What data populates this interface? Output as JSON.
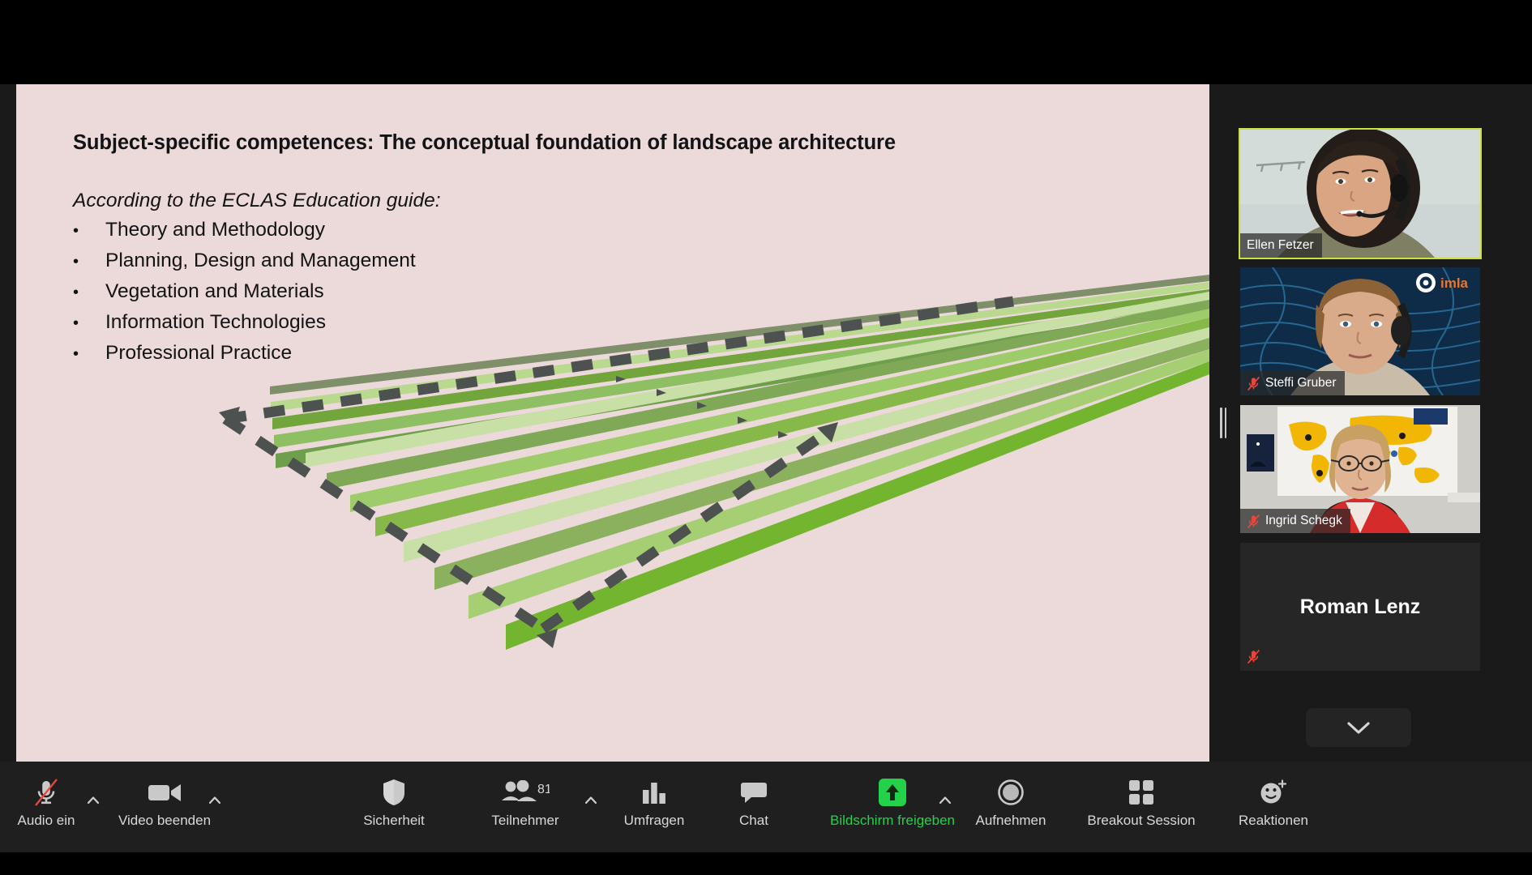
{
  "meeting": {
    "shared_slide": {
      "title": "Subject-specific competences: The conceptual foundation of landscape architecture",
      "lead_in": "According to the ECLAS Education guide:",
      "bullet_marker": "•",
      "bullets": [
        "Theory and Methodology",
        "Planning, Design and Management",
        "Vegetation and Materials",
        "Information Technologies",
        "Professional Practice"
      ],
      "background_color": "#ecd9d9",
      "text_color": "#131313",
      "graphic": {
        "name": "perspective-green-stripes-diagram",
        "dashed_outline_color": "#4d5250",
        "stripe_colors": [
          "#7f8f6a",
          "#b9d98f",
          "#72a63c",
          "#8fbf63",
          "#6f9f4c",
          "#c8e0a6",
          "#7fa857",
          "#9fcc6a",
          "#86b94a",
          "#73b52f"
        ]
      }
    },
    "video_panel": {
      "tiles": [
        {
          "name": "Ellen Fetzer",
          "muted": false,
          "active_speaker": true,
          "video_on": true,
          "background": "light-wall"
        },
        {
          "name": "Steffi Gruber",
          "muted": true,
          "active_speaker": false,
          "video_on": true,
          "background": "imla-topographic-blue",
          "watermark": "imla"
        },
        {
          "name": "Ingrid Schegk",
          "muted": true,
          "active_speaker": false,
          "video_on": true,
          "background": "world-map-wall"
        },
        {
          "name": "Roman Lenz",
          "muted": true,
          "active_speaker": false,
          "video_on": false,
          "background": "none"
        }
      ],
      "active_speaker_border_color": "#c9e23e",
      "mute_icon_color": "#e8453c",
      "scroll_down_label": "chevron-down-icon"
    },
    "toolbar": {
      "items": [
        {
          "key": "audio",
          "label": "Audio ein",
          "icon": "microphone-muted-icon",
          "caret": true,
          "highlight": false
        },
        {
          "key": "video",
          "label": "Video beenden",
          "icon": "camera-icon",
          "caret": true,
          "highlight": false
        },
        {
          "key": "security",
          "label": "Sicherheit",
          "icon": "shield-icon",
          "caret": false,
          "highlight": false
        },
        {
          "key": "participants",
          "label": "Teilnehmer",
          "icon": "people-icon",
          "caret": true,
          "highlight": false,
          "badge": "81"
        },
        {
          "key": "polls",
          "label": "Umfragen",
          "icon": "bar-chart-icon",
          "caret": false,
          "highlight": false
        },
        {
          "key": "chat",
          "label": "Chat",
          "icon": "speech-bubble-icon",
          "caret": false,
          "highlight": false
        },
        {
          "key": "share",
          "label": "Bildschirm freigeben",
          "icon": "share-screen-icon",
          "caret": true,
          "highlight": true
        },
        {
          "key": "record",
          "label": "Aufnehmen",
          "icon": "record-circle-icon",
          "caret": false,
          "highlight": false
        },
        {
          "key": "breakout",
          "label": "Breakout Session",
          "icon": "grid-squares-icon",
          "caret": false,
          "highlight": false
        },
        {
          "key": "reactions",
          "label": "Reaktionen",
          "icon": "smiley-plus-icon",
          "caret": false,
          "highlight": false
        }
      ],
      "participant_count": "81",
      "share_active_color": "#23d14a",
      "background_color": "#1f1f1f"
    }
  }
}
